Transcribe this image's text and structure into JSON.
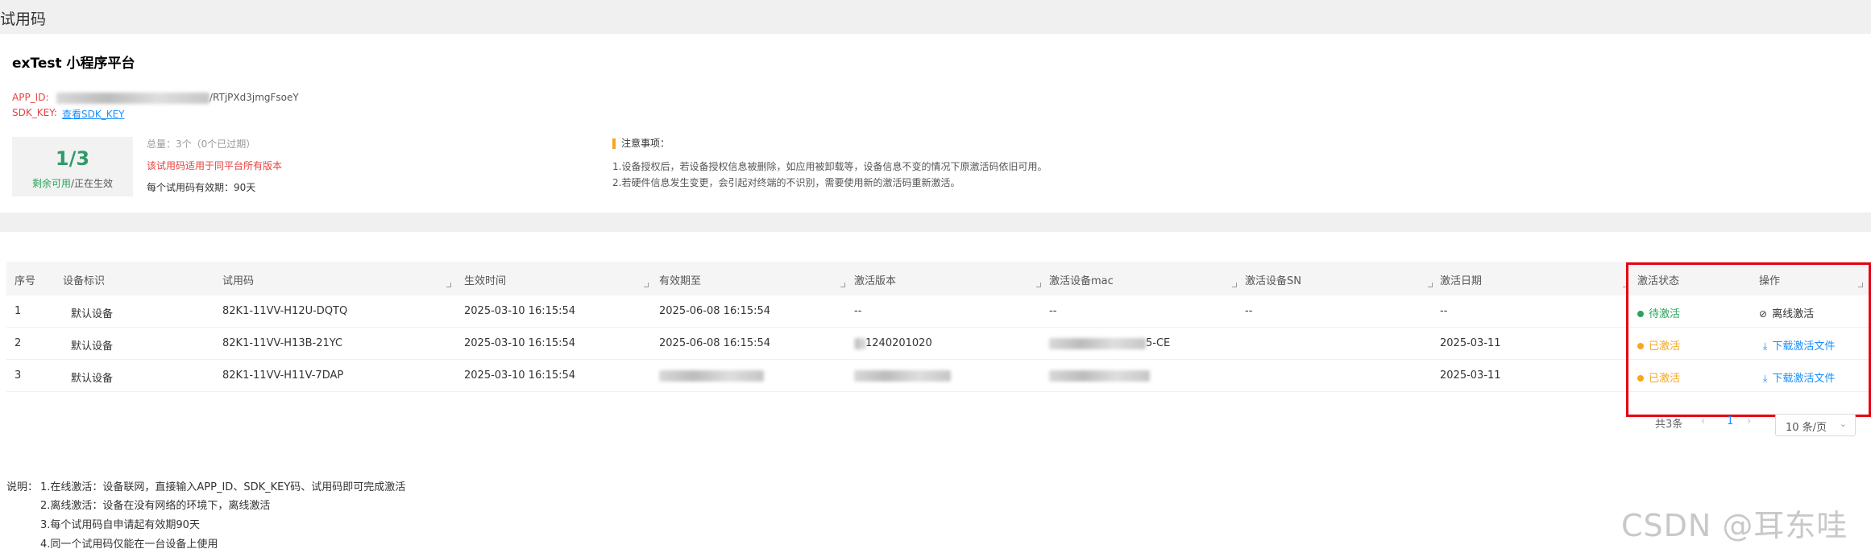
{
  "page_title": "试用码",
  "app": {
    "name": "exTest 小程序平台",
    "app_id_label": "APP_ID:",
    "app_id_value": "/RTjPXd3jmgFsoeY",
    "sdk_key_label": "SDK_KEY:",
    "sdk_key_link": "查看SDK_KEY"
  },
  "stats": {
    "ratio": "1/3",
    "remaining_label": "剩余可用",
    "active_label": "/正在生效",
    "total": "总量：3个（0个已过期）",
    "note_red": "该试用码适用于同平台所有版本",
    "validity": "每个试用码有效期：90天"
  },
  "notes": {
    "title": "注意事项：",
    "lines": [
      "1.设备授权后，若设备授权信息被删除，如应用被卸载等，设备信息不变的情况下原激活码依旧可用。",
      "2.若硬件信息发生变更，会引起对终端的不识别，需要使用新的激活码重新激活。"
    ]
  },
  "table": {
    "columns": [
      "序号",
      "设备标识",
      "试用码",
      "生效时间",
      "有效期至",
      "激活版本",
      "激活设备mac",
      "激活设备SN",
      "激活日期",
      "激活状态",
      "操作"
    ],
    "rows": [
      {
        "index": "1",
        "device": "默认设备",
        "code": "82K1-11VV-H12U-DQTQ",
        "start": "2025-03-10 16:15:54",
        "expire": "2025-06-08 16:15:54",
        "version": "--",
        "mac": "--",
        "sn": "--",
        "activated_on": "--",
        "status": "待激活",
        "status_color": "#2aa55b",
        "action": "离线激活",
        "action_icon": "offline-icon"
      },
      {
        "index": "2",
        "device": "默认设备",
        "code": "82K1-11VV-H13B-21YC",
        "start": "2025-03-10 16:15:54",
        "expire": "2025-06-08 16:15:54",
        "version": "1240201020",
        "mac": "5-CE",
        "sn": "",
        "activated_on": "2025-03-11",
        "status": "已激活",
        "status_color": "#f5a623",
        "action": "下载激活文件",
        "action_icon": "download-icon"
      },
      {
        "index": "3",
        "device": "默认设备",
        "code": "82K1-11VV-H11V-7DAP",
        "start": "2025-03-10 16:15:54",
        "expire": "2025-06-08 16:15:54",
        "version": "",
        "mac": "",
        "sn": "",
        "activated_on": "2025-03-11",
        "status": "已激活",
        "status_color": "#f5a623",
        "action": "下载激活文件",
        "action_icon": "download-icon"
      }
    ]
  },
  "pagination": {
    "total": "共3条",
    "prev": "‹",
    "current": "1",
    "next": "›",
    "page_size": "10 条/页"
  },
  "explanation": {
    "label": "说明：",
    "lines": [
      "1.在线激活：设备联网，直接输入APP_ID、SDK_KEY码、试用码即可完成激活",
      "2.离线激活：设备在没有网络的环境下，离线激活",
      "3.每个试用码自申请起有效期90天",
      "4.同一个试用码仅能在一台设备上使用"
    ]
  },
  "watermark": "CSDN @耳东哇"
}
